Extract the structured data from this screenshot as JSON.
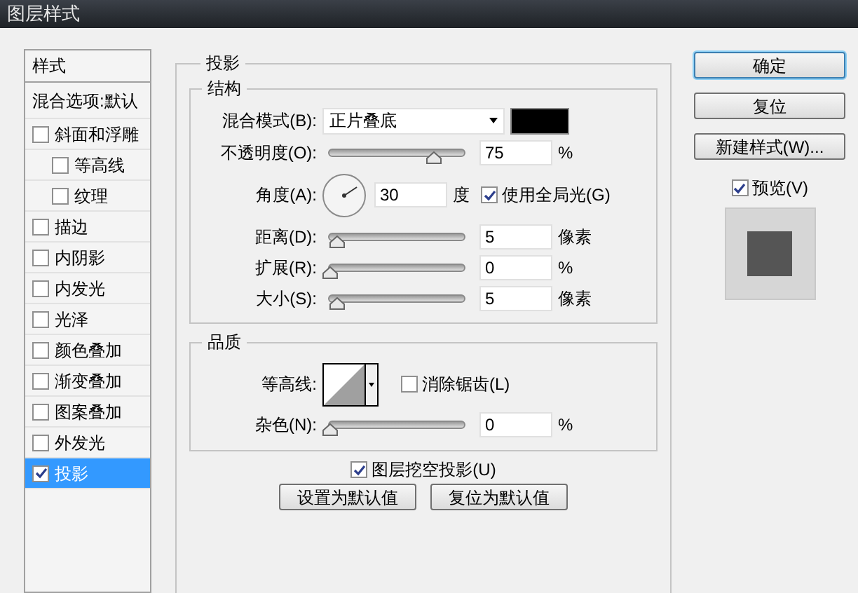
{
  "window": {
    "title": "图层样式"
  },
  "styles_list": {
    "header": "样式",
    "items": [
      {
        "kind": "plain",
        "label": "混合选项:默认",
        "selected": false
      },
      {
        "kind": "check",
        "label": "斜面和浮雕",
        "checked": false,
        "selected": false,
        "children": [
          {
            "kind": "check",
            "label": "等高线",
            "checked": false,
            "selected": false
          },
          {
            "kind": "check",
            "label": "纹理",
            "checked": false,
            "selected": false
          }
        ]
      },
      {
        "kind": "check",
        "label": "描边",
        "checked": false,
        "selected": false
      },
      {
        "kind": "check",
        "label": "内阴影",
        "checked": false,
        "selected": false
      },
      {
        "kind": "check",
        "label": "内发光",
        "checked": false,
        "selected": false
      },
      {
        "kind": "check",
        "label": "光泽",
        "checked": false,
        "selected": false
      },
      {
        "kind": "check",
        "label": "颜色叠加",
        "checked": false,
        "selected": false
      },
      {
        "kind": "check",
        "label": "渐变叠加",
        "checked": false,
        "selected": false
      },
      {
        "kind": "check",
        "label": "图案叠加",
        "checked": false,
        "selected": false
      },
      {
        "kind": "check",
        "label": "外发光",
        "checked": false,
        "selected": false
      },
      {
        "kind": "check",
        "label": "投影",
        "checked": true,
        "selected": true
      }
    ]
  },
  "panel": {
    "title": "投影",
    "structure": {
      "title": "结构",
      "rows": [
        {
          "kind": "blend",
          "label": "混合模式(B):",
          "value": "正片叠底",
          "color": "#000000"
        },
        {
          "kind": "slider",
          "label": "不透明度(O):",
          "level": 0.75,
          "value": "75",
          "unit": "%"
        },
        {
          "kind": "angle",
          "label": "角度(A):",
          "value": "30",
          "unit": "度",
          "global_light": {
            "label": "使用全局光(G)",
            "checked": true
          }
        },
        {
          "kind": "slider",
          "label": "距离(D):",
          "level": 0.05,
          "value": "5",
          "unit": "像素"
        },
        {
          "kind": "slider",
          "label": "扩展(R):",
          "level": 0,
          "value": "0",
          "unit": "%"
        },
        {
          "kind": "slider",
          "label": "大小(S):",
          "level": 0.05,
          "value": "5",
          "unit": "像素"
        }
      ]
    },
    "quality": {
      "title": "品质",
      "contour": {
        "label": "等高线:"
      },
      "anti_alias": {
        "label": "消除锯齿(L)",
        "checked": false
      },
      "noise": {
        "label": "杂色(N):",
        "level": 0,
        "value": "0",
        "unit": "%"
      }
    },
    "knockout": {
      "label": "图层挖空投影(U)",
      "checked": true
    },
    "buttons": [
      "设置为默认值",
      "复位为默认值"
    ]
  },
  "actions": {
    "buttons": [
      {
        "kind": "default",
        "label": "确定"
      },
      {
        "kind": "normal",
        "label": "复位"
      },
      {
        "kind": "normal",
        "label": "新建样式(W)..."
      }
    ],
    "preview": {
      "label": "预览(V)",
      "checked": true
    }
  }
}
